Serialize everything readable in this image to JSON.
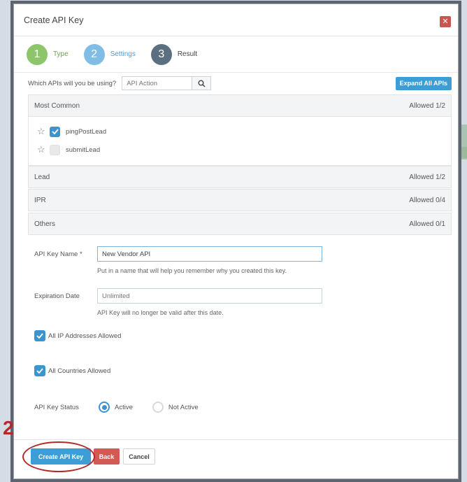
{
  "modal": {
    "title": "Create API Key",
    "close_icon": "close-icon"
  },
  "steps": [
    {
      "number": "1",
      "label": "Type"
    },
    {
      "number": "2",
      "label": "Settings"
    },
    {
      "number": "3",
      "label": "Result"
    }
  ],
  "api_select": {
    "question": "Which APIs will you be using?",
    "search_placeholder": "API Action",
    "expand_label": "Expand All APIs"
  },
  "sections": [
    {
      "name": "Most Common",
      "allowed": "Allowed 1/2",
      "items": [
        {
          "label": "pingPostLead",
          "checked": true
        },
        {
          "label": "submitLead",
          "checked": false
        }
      ]
    },
    {
      "name": "Lead",
      "allowed": "Allowed 1/2"
    },
    {
      "name": "IPR",
      "allowed": "Allowed 0/4"
    },
    {
      "name": "Others",
      "allowed": "Allowed 0/1"
    }
  ],
  "form": {
    "name_label": "API Key Name *",
    "name_value": "New Vendor API",
    "name_hint": "Put in a name that will help you remember why you created this key.",
    "expiration_label": "Expiration Date",
    "expiration_placeholder": "Unlimited",
    "expiration_hint": "API Key will no longer be valid after this date.",
    "all_ip_label": "All IP Addresses Allowed",
    "all_countries_label": "All Countries Allowed",
    "status_label": "API Key Status",
    "status_options": [
      "Active",
      "Not Active"
    ],
    "status_selected": "Active"
  },
  "footer": {
    "create_label": "Create API Key",
    "back_label": "Back",
    "cancel_label": "Cancel"
  },
  "annotation": {
    "number": "2"
  },
  "colors": {
    "primary": "#3d9ed6",
    "danger": "#d25a55",
    "step_done": "#8cc56a",
    "annotation": "#b42a2a"
  }
}
